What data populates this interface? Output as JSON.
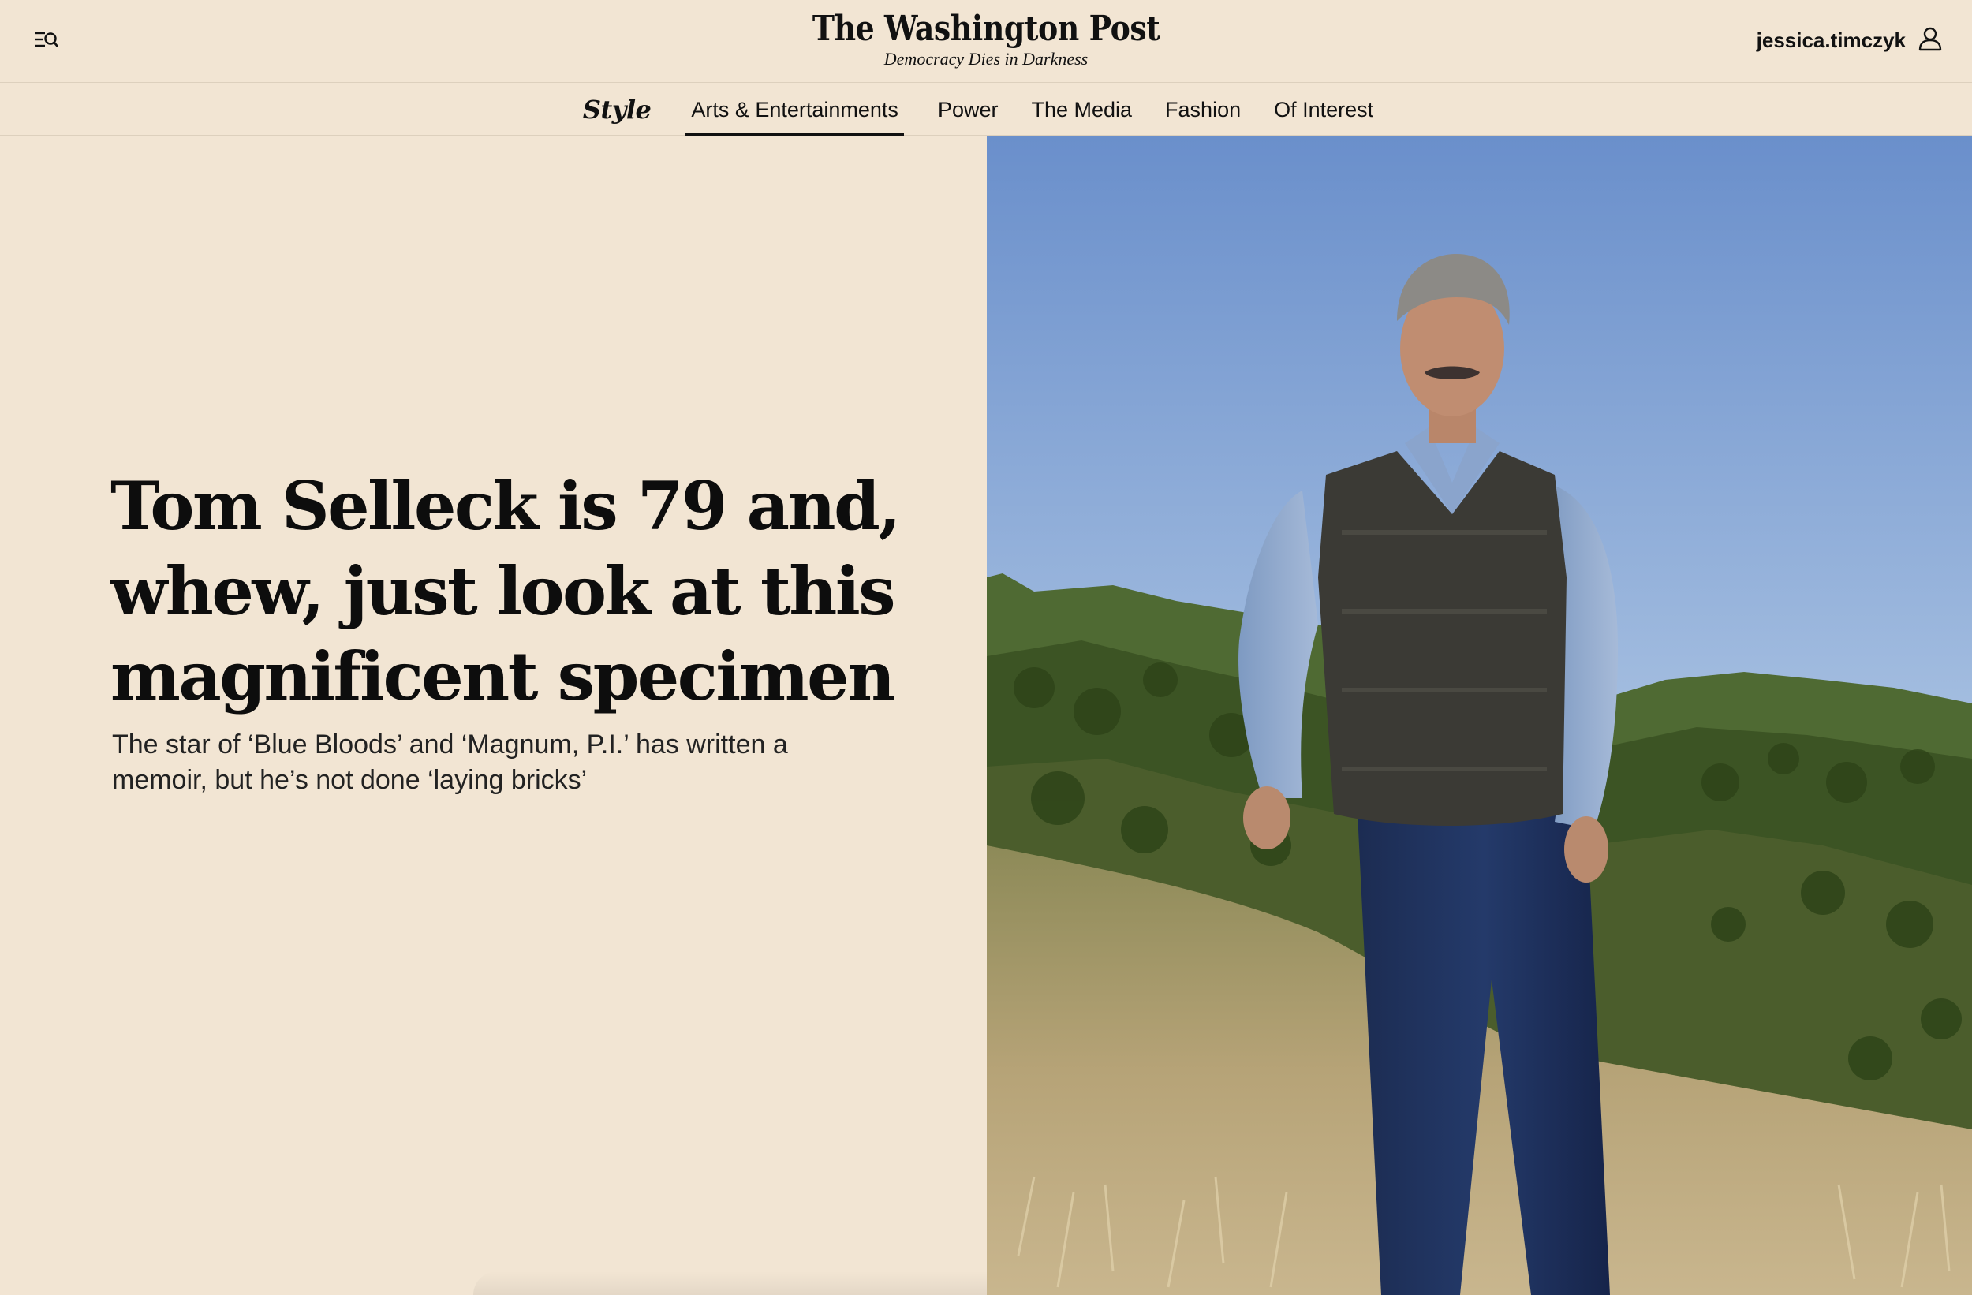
{
  "header": {
    "logo": "The Washington Post",
    "tagline": "Democracy Dies in Darkness",
    "username": "jessica.timczyk",
    "menu_icon": "menu-search-icon",
    "account_icon": "user-icon"
  },
  "nav": {
    "section": "Style",
    "items": [
      {
        "label": "Arts & Entertainments",
        "active": true
      },
      {
        "label": "Power",
        "active": false
      },
      {
        "label": "The Media",
        "active": false
      },
      {
        "label": "Fashion",
        "active": false
      },
      {
        "label": "Of Interest",
        "active": false
      }
    ]
  },
  "article": {
    "headline": "Tom Selleck is 79 and, whew, just look at this magnificent specimen",
    "subhead": "The star of ‘Blue Bloods’ and ‘Magnum, P.I.’ has written a memoir, but he’s not done ‘laying bricks’"
  },
  "colors": {
    "background": "#f2e5d3",
    "text": "#111111",
    "sky": "#6f93c9",
    "hills": "#3f5a26",
    "grass": "#b9a37a"
  }
}
